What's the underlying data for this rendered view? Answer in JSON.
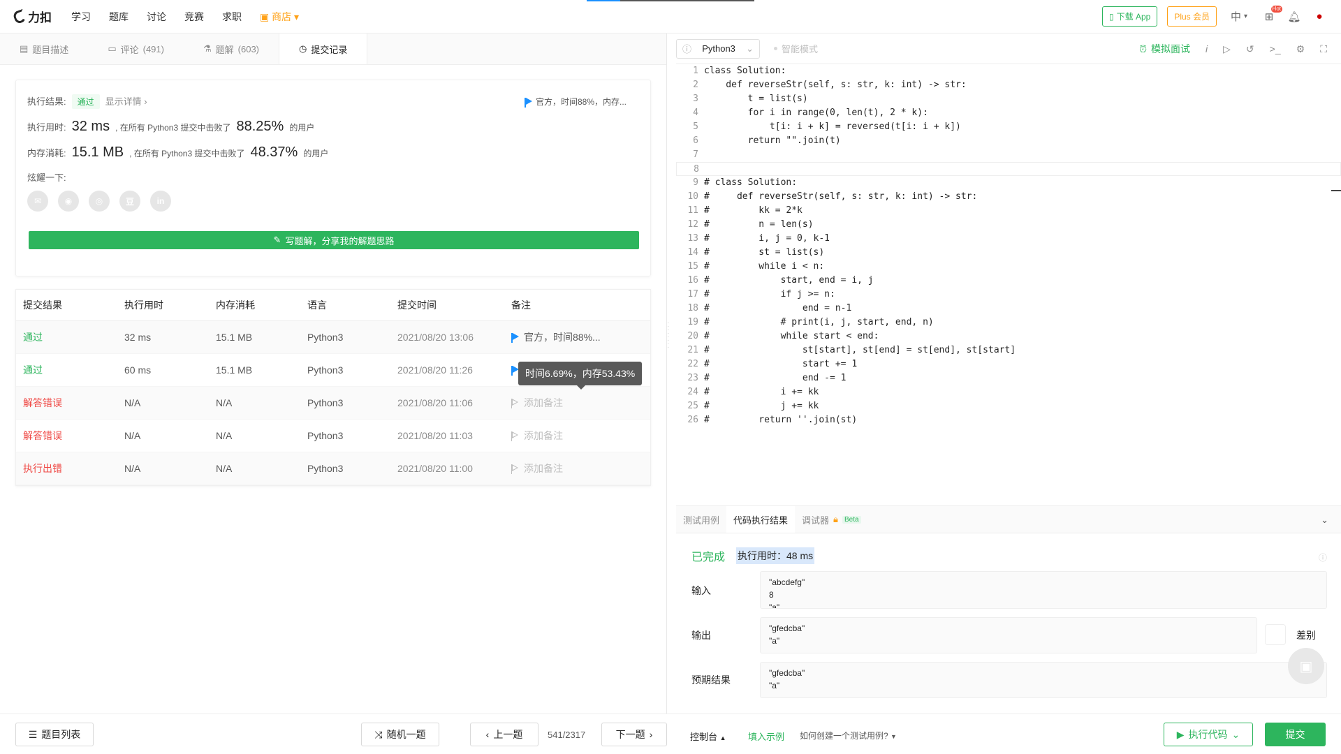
{
  "nav": {
    "logo_text": "力扣",
    "items": [
      "学习",
      "题库",
      "讨论",
      "竞赛",
      "求职"
    ],
    "shop": "商店",
    "download_app": "下载 App",
    "plus": "Plus 会员",
    "lang": "中",
    "hot_badge": "Hot"
  },
  "tabs": [
    {
      "label": "题目描述",
      "count": ""
    },
    {
      "label": "评论",
      "count": "(491)"
    },
    {
      "label": "题解",
      "count": "(603)"
    },
    {
      "label": "提交记录",
      "count": ""
    }
  ],
  "summary": {
    "result_label": "执行结果:",
    "result_value": "通过",
    "show_detail": "显示详情 ›",
    "official_note": "官方，时间88%，内存...",
    "time_label": "执行用时:",
    "time_value": "32 ms",
    "time_desc": ", 在所有 Python3 提交中击败了",
    "time_pct": "88.25%",
    "time_suffix": "的用户",
    "mem_label": "内存消耗:",
    "mem_value": "15.1 MB",
    "mem_desc": ", 在所有 Python3 提交中击败了",
    "mem_pct": "48.37%",
    "mem_suffix": "的用户",
    "share_label": "炫耀一下:",
    "share_icons": [
      "wechat-icon",
      "weibo-icon",
      "qq-icon",
      "douban-icon",
      "linkedin-icon"
    ],
    "share_glyphs": [
      "✉",
      "◉",
      "◎",
      "豆",
      "in"
    ],
    "write_btn": "写题解，分享我的解题思路"
  },
  "table": {
    "headers": [
      "提交结果",
      "执行用时",
      "内存消耗",
      "语言",
      "提交时间",
      "备注"
    ],
    "rows": [
      {
        "status": "通过",
        "status_type": "pass",
        "time": "32 ms",
        "mem": "15.1 MB",
        "lang": "Python3",
        "submitted": "2021/08/20 13:06",
        "note": "官方，时间88%...",
        "note_type": "flag"
      },
      {
        "status": "通过",
        "status_type": "pass",
        "time": "60 ms",
        "mem": "15.1 MB",
        "lang": "Python3",
        "submitted": "2021/08/20 11:26",
        "note": "时间6.69%，内存5...",
        "note_type": "flag"
      },
      {
        "status": "解答错误",
        "status_type": "err",
        "time": "N/A",
        "mem": "N/A",
        "lang": "Python3",
        "submitted": "2021/08/20 11:06",
        "note": "添加备注",
        "note_type": "add"
      },
      {
        "status": "解答错误",
        "status_type": "err",
        "time": "N/A",
        "mem": "N/A",
        "lang": "Python3",
        "submitted": "2021/08/20 11:03",
        "note": "添加备注",
        "note_type": "add"
      },
      {
        "status": "执行出错",
        "status_type": "err",
        "time": "N/A",
        "mem": "N/A",
        "lang": "Python3",
        "submitted": "2021/08/20 11:00",
        "note": "添加备注",
        "note_type": "add"
      }
    ],
    "tooltip": "时间6.69%，内存53.43%"
  },
  "editor": {
    "language": "Python3",
    "smart_mode": "智能模式",
    "mock_interview": "模拟面试",
    "lines": [
      "class Solution:",
      "    def reverseStr(self, s: str, k: int) -> str:",
      "        t = list(s)",
      "        for i in range(0, len(t), 2 * k):",
      "            t[i: i + k] = reversed(t[i: i + k])",
      "        return \"\".join(t)",
      "",
      "",
      "# class Solution:",
      "#     def reverseStr(self, s: str, k: int) -> str:",
      "#         kk = 2*k",
      "#         n = len(s)",
      "#         i, j = 0, k-1",
      "#         st = list(s)",
      "#         while i < n:",
      "#             start, end = i, j",
      "#             if j >= n:",
      "#                 end = n-1",
      "#             # print(i, j, start, end, n)",
      "#             while start < end:",
      "#                 st[start], st[end] = st[end], st[start]",
      "#                 start += 1",
      "#                 end -= 1",
      "#             i += kk",
      "#             j += kk",
      "#         return ''.join(st)"
    ]
  },
  "result": {
    "tabs": [
      "测试用例",
      "代码执行结果",
      "调试器"
    ],
    "beta": "Beta",
    "done": "已完成",
    "exec_time": "执行用时：48 ms",
    "input_label": "输入",
    "input_lines": [
      "\"abcdefg\"",
      "8",
      "\"a\""
    ],
    "output_label": "输出",
    "output_lines": [
      "\"gfedcba\"",
      "\"a\""
    ],
    "diff_label": "差别",
    "expected_label": "预期结果",
    "expected_lines": [
      "\"gfedcba\"",
      "\"a\""
    ]
  },
  "bottom": {
    "problem_list": "题目列表",
    "random": "随机一题",
    "prev": "上一题",
    "page": "541/2317",
    "next": "下一题",
    "console": "控制台",
    "fill_example": "填入示例",
    "howto": "如何创建一个测试用例?",
    "run_code": "执行代码",
    "submit": "提交"
  },
  "colors": {
    "accent_green": "#2db55d",
    "error_red": "#ef4743",
    "shop_orange": "#ffa116",
    "flag_blue": "#1a90ff"
  }
}
